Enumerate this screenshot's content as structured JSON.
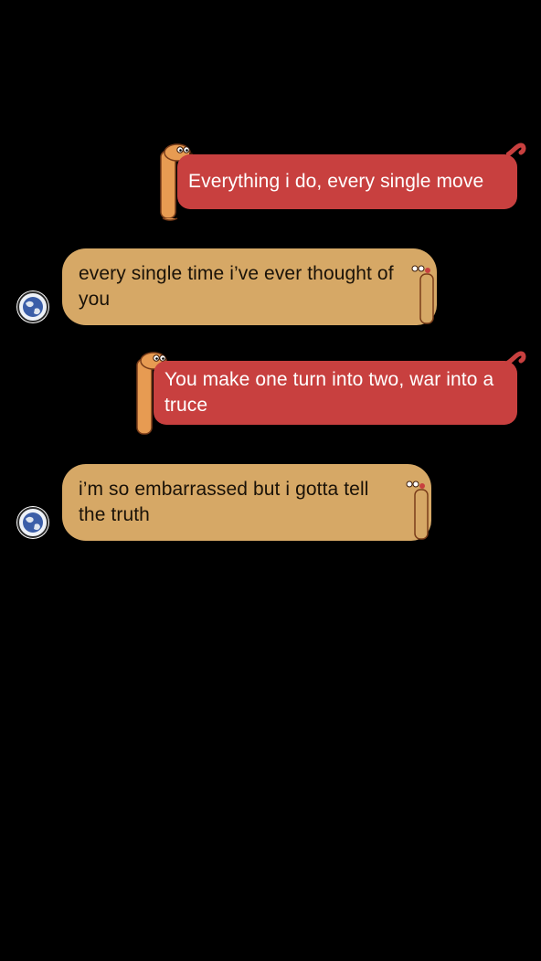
{
  "conversation": {
    "messages": [
      {
        "direction": "outgoing",
        "text": "Everything i do, every single move"
      },
      {
        "direction": "incoming",
        "text": "every single time i’ve ever thought of you"
      },
      {
        "direction": "outgoing",
        "text": "You make one turn into two, war into a truce"
      },
      {
        "direction": "incoming",
        "text": "i’m so embarrassed but i gotta tell the truth"
      }
    ]
  },
  "theme": {
    "background": "#000000",
    "outgoing_bubble": "#c8403f",
    "incoming_bubble": "#d6a866",
    "dog_color": "#e79b52",
    "avatar_icon": "globe-icon"
  }
}
